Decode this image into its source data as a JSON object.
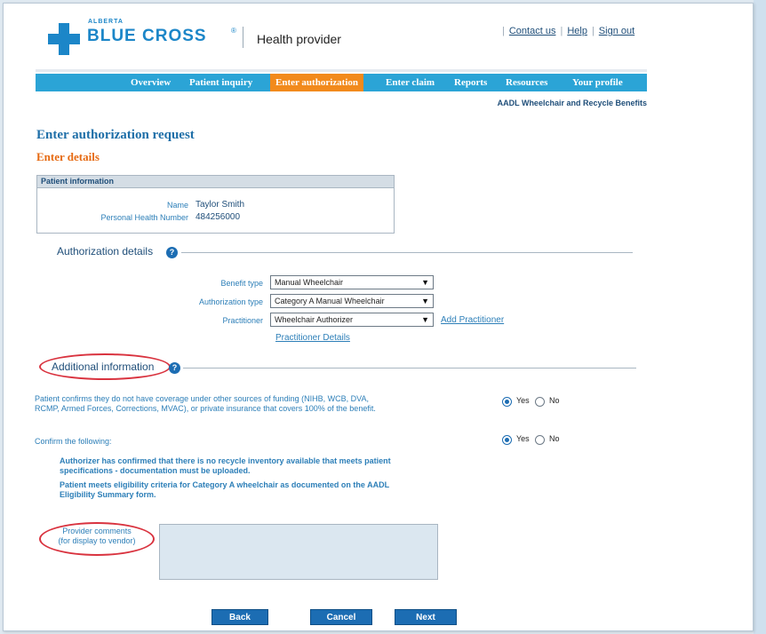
{
  "header": {
    "logo_small": "ALBERTA",
    "logo_brand": "BLUE CROSS",
    "logo_reg": "®",
    "portal_title": "Health provider",
    "links": [
      "Contact us",
      "Help",
      "Sign out"
    ]
  },
  "nav": {
    "items": [
      "Overview",
      "Patient inquiry",
      "Enter authorization",
      "Enter claim",
      "Reports",
      "Resources",
      "Your profile"
    ],
    "active": "Enter authorization",
    "subtitle": "AADL Wheelchair and Recycle Benefits"
  },
  "page": {
    "title": "Enter authorization request",
    "subtitle": "Enter details"
  },
  "patient": {
    "header": "Patient information",
    "name_label": "Name",
    "name_value": "Taylor Smith",
    "phn_label": "Personal Health Number",
    "phn_value": "484256000"
  },
  "authorization": {
    "section_title": "Authorization details",
    "benefit_type_label": "Benefit type",
    "benefit_type_value": "Manual Wheelchair",
    "auth_type_label": "Authorization type",
    "auth_type_value": "Category A Manual Wheelchair",
    "practitioner_label": "Practitioner",
    "practitioner_value": "Wheelchair Authorizer",
    "add_practitioner": "Add Practitioner",
    "practitioner_details": "Practitioner Details"
  },
  "additional": {
    "section_title": "Additional information",
    "q1_line1": "Patient confirms they do not have coverage under other sources of funding (NIHB, WCB, DVA,",
    "q1_line2": "RCMP, Armed Forces, Corrections, MVAC), or private insurance that covers 100% of the benefit.",
    "q1_answer": "Yes",
    "q2": "Confirm the following:",
    "q2_answer": "Yes",
    "yes_label": "Yes",
    "no_label": "No",
    "confirm1_line1": "Authorizer has confirmed that there is no recycle inventory available that meets patient",
    "confirm1_line2": "specifications - documentation must be uploaded.",
    "confirm2_line1": "Patient meets eligibility criteria for Category A wheelchair as documented on the AADL",
    "confirm2_line2": "Eligibility Summary form.",
    "comments_label_line1": "Provider comments",
    "comments_label_line2": "(for display to vendor)",
    "comments_value": ""
  },
  "buttons": {
    "back": "Back",
    "cancel": "Cancel",
    "next": "Next"
  },
  "colors": {
    "brand_blue": "#1c86c8",
    "nav_blue": "#2ba4d6",
    "nav_active": "#f28a1c",
    "heading_orange": "#e66a12",
    "annotation_red": "#d9333f",
    "button_blue": "#1c6db3"
  }
}
